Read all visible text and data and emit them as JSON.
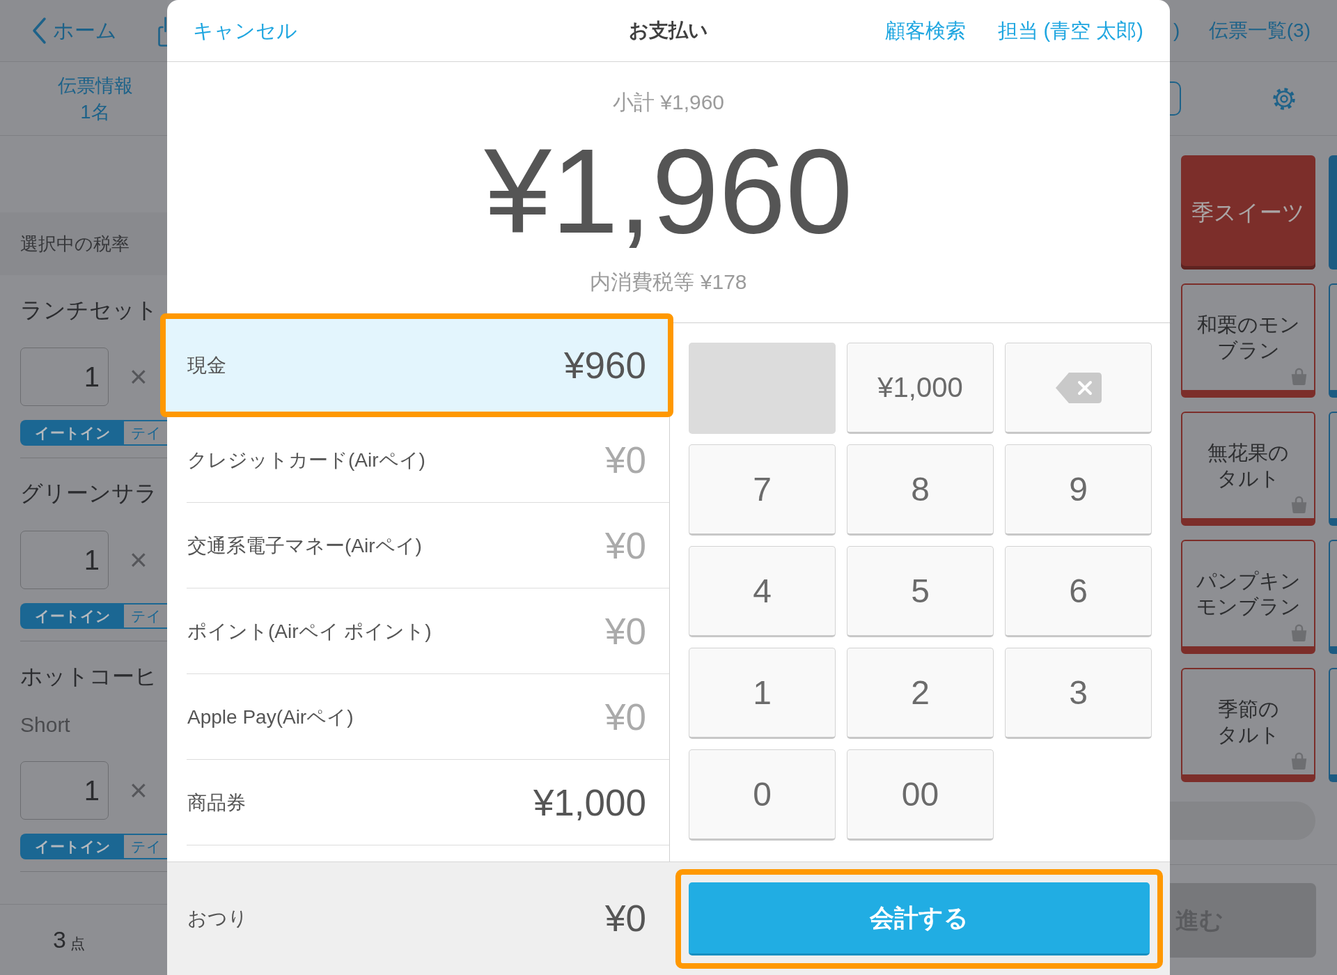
{
  "background_app": {
    "left_panel": {
      "back_button": {
        "label": "ホーム"
      },
      "slip_info": {
        "title": "伝票情報",
        "guests": "1名"
      },
      "tax_rate_label": "選択中の税率",
      "order_items": [
        {
          "name": "ランチセット",
          "quantity": "1",
          "multiply_sign": "×",
          "options": [
            {
              "label": "イートイン",
              "selected": true
            },
            {
              "label": "テイ",
              "selected": false
            }
          ]
        },
        {
          "name": "グリーンサラ",
          "quantity": "1",
          "multiply_sign": "×",
          "options": [
            {
              "label": "イートイン",
              "selected": true
            },
            {
              "label": "テイ",
              "selected": false
            }
          ]
        },
        {
          "name": "ホットコーヒ",
          "variant": "Short",
          "quantity": "1",
          "multiply_sign": "×",
          "options": [
            {
              "label": "イートイン",
              "selected": true
            },
            {
              "label": "テイ",
              "selected": false
            }
          ]
        }
      ],
      "item_count": {
        "value": "3",
        "unit": "点"
      }
    },
    "right_panel": {
      "cut_label": ")",
      "slip_list_button": "伝票一覧(3)",
      "tile_columns": [
        {
          "color": "#7c2e2a",
          "tiles": [
            {
              "kind": "category",
              "lines": [
                "季スイーツ"
              ]
            },
            {
              "kind": "product",
              "lines": [
                "和栗のモン",
                "ブラン"
              ]
            },
            {
              "kind": "product",
              "lines": [
                "無花果の",
                "タルト"
              ]
            },
            {
              "kind": "product",
              "lines": [
                "パンプキン",
                "モンブラン"
              ]
            },
            {
              "kind": "product",
              "lines": [
                "季節の",
                "タルト"
              ]
            }
          ]
        },
        {
          "color": "#1d5b82",
          "tiles": [
            {
              "kind": "category_edge"
            },
            {
              "kind": "product_edge"
            },
            {
              "kind": "product_edge"
            },
            {
              "kind": "product_edge"
            },
            {
              "kind": "product_edge"
            }
          ]
        }
      ],
      "next_button": "進む"
    }
  },
  "payment_dialog": {
    "cancel_button": "キャンセル",
    "title": "お支払い",
    "customer_search_button": "顧客検索",
    "staff_button": "担当 (青空 太郎)",
    "subtotal": "小計 ¥1,960",
    "total": "¥1,960",
    "tax_included": "内消費税等 ¥178",
    "payment_methods": [
      {
        "name": "現金",
        "amount": "¥960",
        "selected": true,
        "highlighted": true,
        "entered": true
      },
      {
        "name": "クレジットカード(Airペイ)",
        "amount": "¥0",
        "selected": false,
        "highlighted": false,
        "entered": false
      },
      {
        "name": "交通系電子マネー(Airペイ)",
        "amount": "¥0",
        "selected": false,
        "highlighted": false,
        "entered": false
      },
      {
        "name": "ポイント(Airペイ ポイント)",
        "amount": "¥0",
        "selected": false,
        "highlighted": false,
        "entered": false
      },
      {
        "name": "Apple Pay(Airペイ)",
        "amount": "¥0",
        "selected": false,
        "highlighted": false,
        "entered": false
      },
      {
        "name": "商品券",
        "amount": "¥1,000",
        "selected": false,
        "highlighted": false,
        "entered": true
      }
    ],
    "change": {
      "label": "おつり",
      "amount": "¥0"
    },
    "keypad": [
      {
        "kind": "blank"
      },
      {
        "kind": "amount",
        "label": "¥1,000"
      },
      {
        "kind": "backspace"
      },
      {
        "kind": "digit",
        "label": "7"
      },
      {
        "kind": "digit",
        "label": "8"
      },
      {
        "kind": "digit",
        "label": "9"
      },
      {
        "kind": "digit",
        "label": "4"
      },
      {
        "kind": "digit",
        "label": "5"
      },
      {
        "kind": "digit",
        "label": "6"
      },
      {
        "kind": "digit",
        "label": "1"
      },
      {
        "kind": "digit",
        "label": "2"
      },
      {
        "kind": "digit",
        "label": "3"
      },
      {
        "kind": "digit",
        "label": "0"
      },
      {
        "kind": "digit",
        "label": "00"
      }
    ],
    "checkout_button": {
      "label": "会計する",
      "highlighted": true
    }
  }
}
